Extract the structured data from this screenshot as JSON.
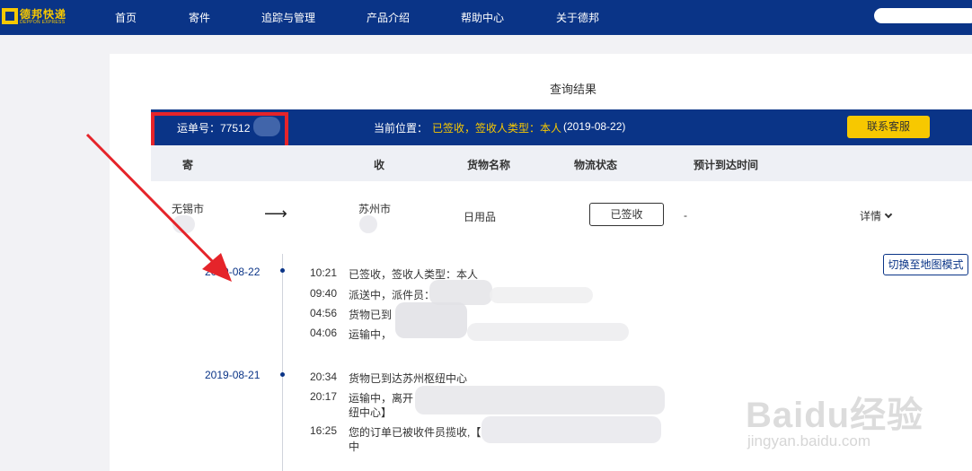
{
  "brand": {
    "name_cn": "德邦快递",
    "name_en": "DEPPON EXPRESS",
    "color_primary": "#0a3487",
    "color_accent": "#f7c800"
  },
  "nav": {
    "items": [
      "首页",
      "寄件",
      "追踪与管理",
      "产品介绍",
      "帮助中心",
      "关于德邦"
    ]
  },
  "search": {
    "placeholder": ""
  },
  "result": {
    "title": "查询结果",
    "waybill_label": "运单号：77512",
    "location_label": "当前位置：",
    "location_value": "已签收，签收人类型：本人",
    "location_date": "(2019-08-22)",
    "contact_button": "联系客服"
  },
  "table": {
    "headers": [
      "寄",
      "收",
      "货物名称",
      "物流状态",
      "预计到达时间"
    ],
    "row": {
      "from": "无锡市",
      "to": "苏州市",
      "goods": "日用品",
      "status": "已签收",
      "eta": "-",
      "detail": "详情"
    }
  },
  "map_button": "切换至地图模式",
  "timeline": [
    {
      "date": "2019-08-22",
      "events": [
        {
          "time": "10:21",
          "desc": "已签收，签收人类型：本人"
        },
        {
          "time": "09:40",
          "desc": "派送中，派件员："
        },
        {
          "time": "04:56",
          "desc": "货物已到"
        },
        {
          "time": "04:06",
          "desc": "运输中，"
        }
      ]
    },
    {
      "date": "2019-08-21",
      "events": [
        {
          "time": "20:34",
          "desc": "货物已到达苏州枢纽中心"
        },
        {
          "time": "20:17",
          "desc": "运输中，离开",
          "desc2": "纽中心】"
        },
        {
          "time": "16:25",
          "desc": "您的订单已被收件员揽收,【",
          "desc2": "中"
        }
      ]
    }
  ],
  "watermark": {
    "main": "Baidu经验",
    "sub": "jingyan.baidu.com"
  },
  "annotation": {
    "color": "#e5242a"
  }
}
